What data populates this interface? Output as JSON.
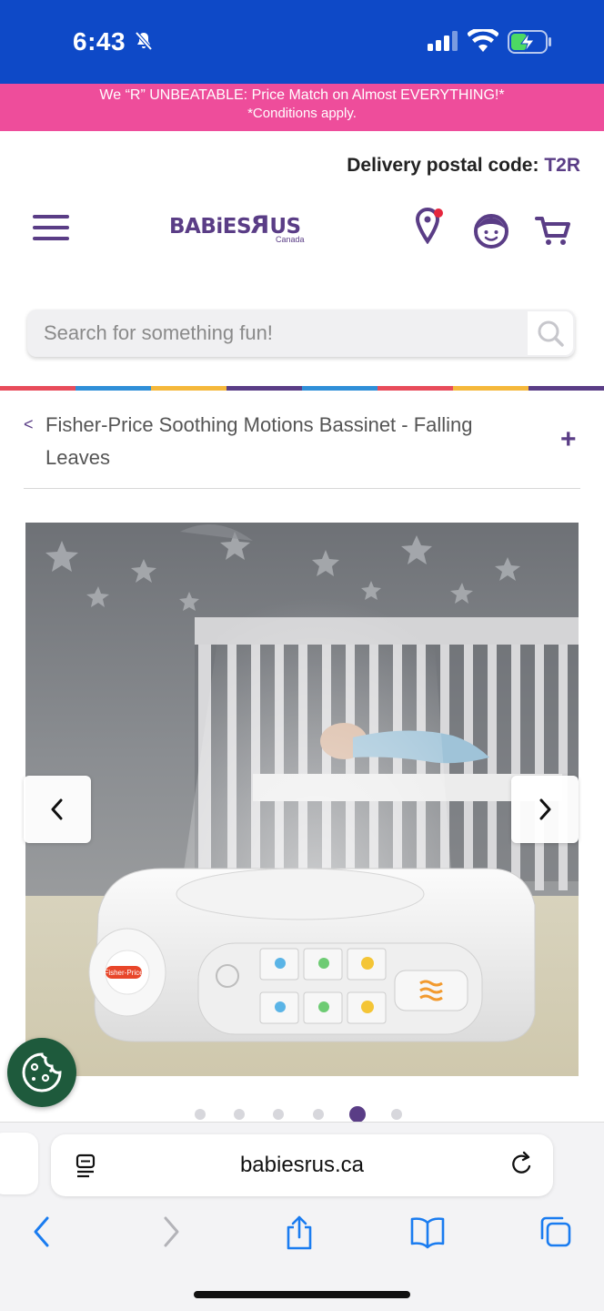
{
  "status_bar": {
    "time": "6:43",
    "bg_color": "#0e49c7",
    "icons": [
      "bell-slash-icon",
      "signal-icon",
      "wifi-icon",
      "battery-charging-icon"
    ]
  },
  "promo": {
    "line1": "We “R” UNBEATABLE: Price Match on Almost EVERYTHING!*",
    "line2": "*Conditions apply.",
    "bg_color": "#ee4d9b"
  },
  "delivery": {
    "label": "Delivery postal code:",
    "code": "T2R"
  },
  "header": {
    "logo_text": "BABiES",
    "logo_r": "R",
    "logo_us": "US",
    "logo_sub": "Canada",
    "brand_color": "#5a3d86",
    "icons": [
      "menu-icon",
      "location-pin-icon",
      "account-icon",
      "cart-icon"
    ]
  },
  "search": {
    "placeholder": "Search for something fun!"
  },
  "rainbow_colors": [
    "#e84c5b",
    "#2f8fd8",
    "#f5b83b",
    "#5a3d86",
    "#2f8fd8",
    "#e84c5b",
    "#f5b83b",
    "#5a3d86"
  ],
  "breadcrumb": {
    "back": "<",
    "title": "Fisher-Price Soothing Motions Bassinet - Falling Leaves",
    "expand": "+"
  },
  "carousel": {
    "total": 6,
    "active_index": 4,
    "product_badge": "Fisher-Price"
  },
  "browser": {
    "url": "babiesrus.ca",
    "icons": [
      "back-icon",
      "forward-icon",
      "share-icon",
      "bookmarks-icon",
      "tabs-icon"
    ]
  }
}
